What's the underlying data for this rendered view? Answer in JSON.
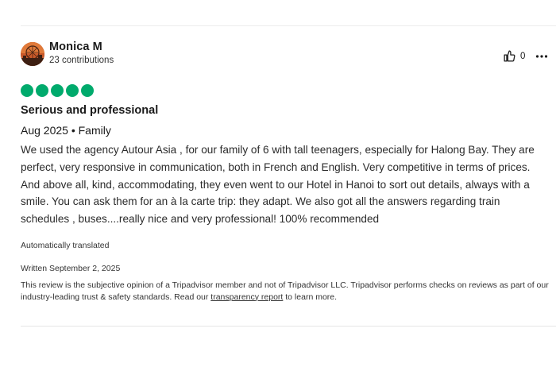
{
  "reviewer": {
    "name": "Monica M",
    "contributions": "23 contributions",
    "avatar_icon": "avatar-photo"
  },
  "actions": {
    "helpful_count": "0",
    "helpful_icon": "thumbs-up-icon",
    "more_icon": "more-options-icon"
  },
  "rating": {
    "value": 5,
    "max": 5,
    "color": "#00aa6c"
  },
  "review": {
    "title": "Serious and professional",
    "trip_meta": "Aug 2025 • Family",
    "body": "We used the agency Autour Asia , for our family of 6 with tall teenagers, especially for Halong Bay. They are perfect, very responsive in communication, both in French and English. Very competitive in terms of prices. And above all, kind, accommodating, they even went to our Hotel in Hanoi to sort out details, always with a smile. You can ask them for an à la carte trip: they adapt. We also got all the answers regarding train schedules , buses....really nice and very professional! 100% recommended",
    "translation_note": "Automatically translated",
    "written": "Written September 2, 2025"
  },
  "disclaimer": {
    "text_before": "This review is the subjective opinion of a Tripadvisor member and not of Tripadvisor LLC. Tripadvisor performs checks on reviews as part of our industry-leading trust & safety standards. Read our ",
    "link_text": "transparency report",
    "text_after": " to learn more."
  }
}
